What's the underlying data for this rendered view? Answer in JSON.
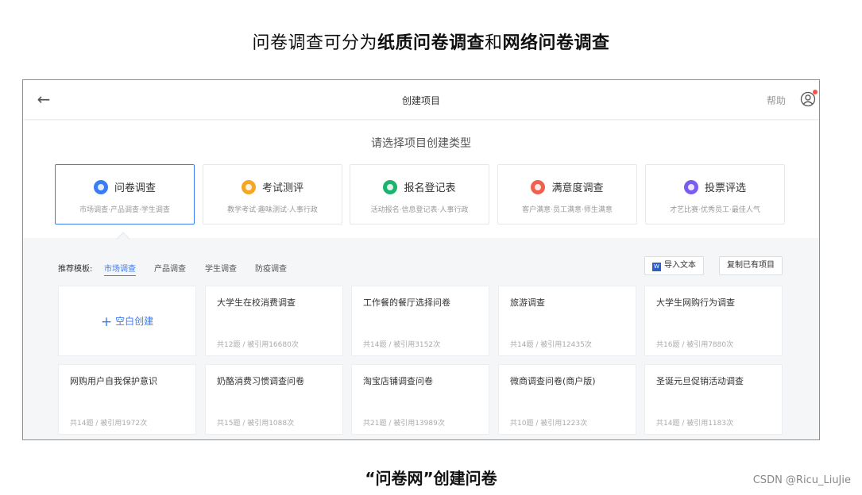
{
  "heading": {
    "prefix": "问卷调查可分为",
    "paper": "纸质问卷调查",
    "and": "和",
    "online": "网络问卷调查"
  },
  "topbar": {
    "title": "创建项目",
    "help": "帮助"
  },
  "prompt": "请选择项目创建类型",
  "types": [
    {
      "label": "问卷调查",
      "desc": "市场调查·产品调查·学生调查",
      "color": "#3b7cf6"
    },
    {
      "label": "考试测评",
      "desc": "教学考试·趣味测试·人事行政",
      "color": "#f5a623"
    },
    {
      "label": "报名登记表",
      "desc": "活动报名·信息登记表·人事行政",
      "color": "#1bb36e"
    },
    {
      "label": "满意度调查",
      "desc": "客户满意·员工满意·师生满意",
      "color": "#f0604d"
    },
    {
      "label": "投票评选",
      "desc": "才艺比赛·优秀员工·最佳人气",
      "color": "#7a5cf0"
    }
  ],
  "templates": {
    "label": "推荐模板:",
    "tabs": [
      "市场调查",
      "产品调查",
      "学生调查",
      "防疫调查"
    ],
    "import_label": "导入文本",
    "copy_label": "复制已有项目",
    "blank_label": "空白创建",
    "cards": [
      {
        "title": "大学生在校消费调查",
        "meta": "共12题 / 被引用16680次"
      },
      {
        "title": "工作餐的餐厅选择问卷",
        "meta": "共14题 / 被引用3152次"
      },
      {
        "title": "旅游调查",
        "meta": "共14题 / 被引用12435次"
      },
      {
        "title": "大学生网购行为调查",
        "meta": "共16题 / 被引用7880次"
      },
      {
        "title": "网购用户自我保护意识",
        "meta": "共14题 / 被引用1972次"
      },
      {
        "title": "奶酪消费习惯调查问卷",
        "meta": "共15题 / 被引用1088次"
      },
      {
        "title": "淘宝店铺调查问卷",
        "meta": "共21题 / 被引用13989次"
      },
      {
        "title": "微商调查问卷(商户版)",
        "meta": "共10题 / 被引用1223次"
      },
      {
        "title": "圣诞元旦促销活动调查",
        "meta": "共14题 / 被引用1183次"
      }
    ]
  },
  "caption": "“问卷网”创建问卷",
  "watermark": "CSDN @Ricu_LiuJie"
}
